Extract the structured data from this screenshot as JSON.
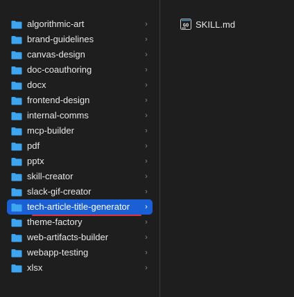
{
  "folders": [
    {
      "label": "algorithmic-art"
    },
    {
      "label": "brand-guidelines"
    },
    {
      "label": "canvas-design"
    },
    {
      "label": "doc-coauthoring"
    },
    {
      "label": "docx"
    },
    {
      "label": "frontend-design"
    },
    {
      "label": "internal-comms"
    },
    {
      "label": "mcp-builder"
    },
    {
      "label": "pdf"
    },
    {
      "label": "pptx"
    },
    {
      "label": "skill-creator"
    },
    {
      "label": "slack-gif-creator"
    },
    {
      "label": "tech-article-title-generator"
    },
    {
      "label": "theme-factory"
    },
    {
      "label": "web-artifacts-builder"
    },
    {
      "label": "webapp-testing"
    },
    {
      "label": "xlsx"
    }
  ],
  "selected_index": 12,
  "chevron_glyph": "›",
  "files": [
    {
      "label": "SKILL.md",
      "icon": "markdown-file-icon"
    }
  ],
  "colors": {
    "selection": "#1a5fd4",
    "folder": "#3ea6f0",
    "annotation_underline": "#e0323a"
  }
}
